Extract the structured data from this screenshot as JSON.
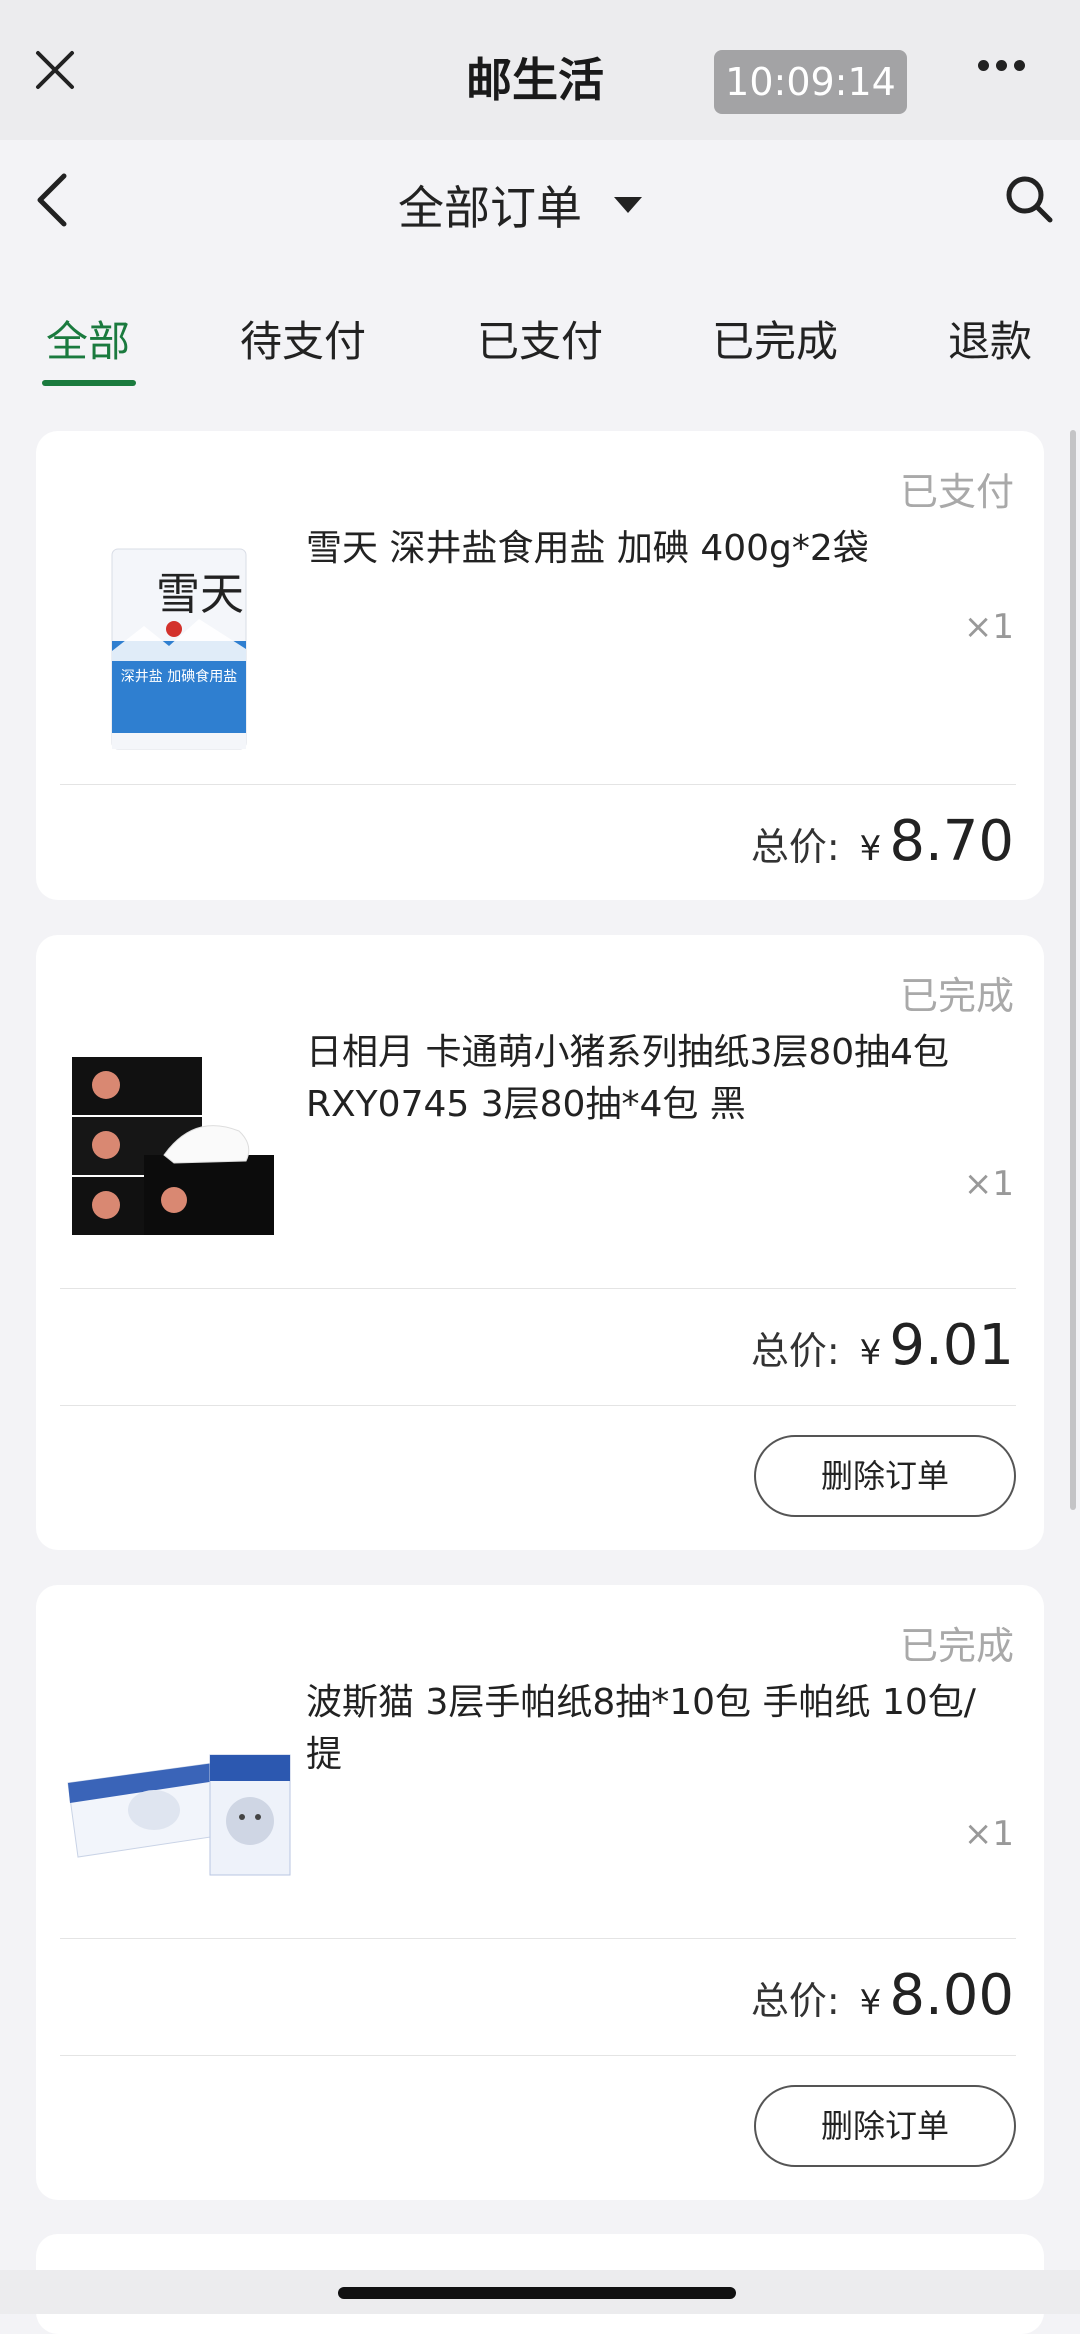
{
  "topbar": {
    "title": "邮生活",
    "time": "10:09:14"
  },
  "navbar": {
    "title": "全部订单"
  },
  "tabs": [
    {
      "label": "全部"
    },
    {
      "label": "待支付"
    },
    {
      "label": "已支付"
    },
    {
      "label": "已完成"
    },
    {
      "label": "退款"
    }
  ],
  "orders": [
    {
      "status": "已支付",
      "name": "雪天 深井盐食用盐 加碘 400g*2袋",
      "qty": "×1",
      "total_label": "总价:",
      "currency": "¥",
      "amount": "8.70"
    },
    {
      "status": "已完成",
      "name": "日相月 卡通萌小猪系列抽纸3层80抽4包 RXY0745 3层80抽*4包 黑",
      "qty": "×1",
      "total_label": "总价:",
      "currency": "¥",
      "amount": "9.01",
      "delete_label": "删除订单"
    },
    {
      "status": "已完成",
      "name": "波斯猫 3层手帕纸8抽*10包 手帕纸 10包/提",
      "qty": "×1",
      "total_label": "总价:",
      "currency": "¥",
      "amount": "8.00",
      "delete_label": "删除订单"
    }
  ],
  "product_images": {
    "salt_brand": "雪天",
    "salt_text": "深井盐 加碘食用盐"
  }
}
